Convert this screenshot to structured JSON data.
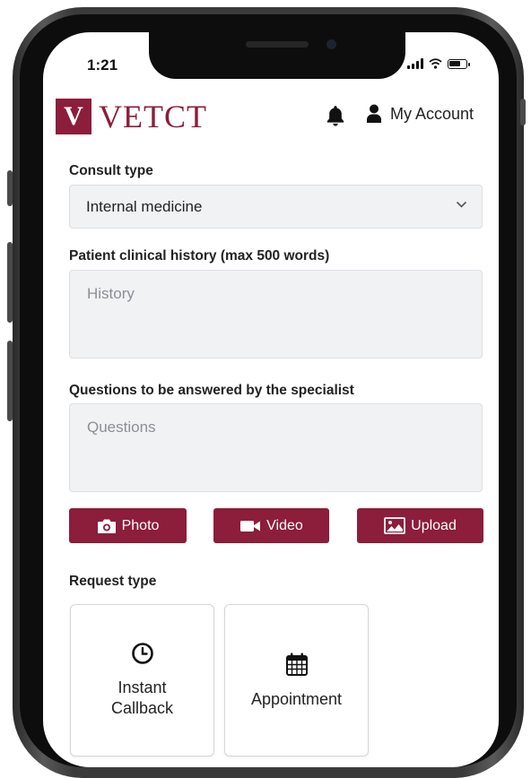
{
  "status_bar": {
    "time": "1:21"
  },
  "header": {
    "logo_mark": "V",
    "logo_text": "VETCT",
    "account_label": "My Account"
  },
  "form": {
    "consult_type": {
      "label": "Consult type",
      "value": "Internal medicine"
    },
    "history": {
      "label": "Patient clinical history (max 500 words)",
      "placeholder": "History"
    },
    "questions": {
      "label": "Questions to be answered by the specialist",
      "placeholder": "Questions"
    },
    "media_buttons": {
      "photo": "Photo",
      "video": "Video",
      "upload": "Upload"
    },
    "request_type": {
      "label": "Request type",
      "options": [
        {
          "line1": "Instant",
          "line2": "Callback",
          "icon": "clock-icon"
        },
        {
          "line1": "Appointment",
          "icon": "calendar-icon"
        }
      ]
    }
  },
  "colors": {
    "brand": "#8c1d3b",
    "field_bg": "#f1f2f4"
  }
}
